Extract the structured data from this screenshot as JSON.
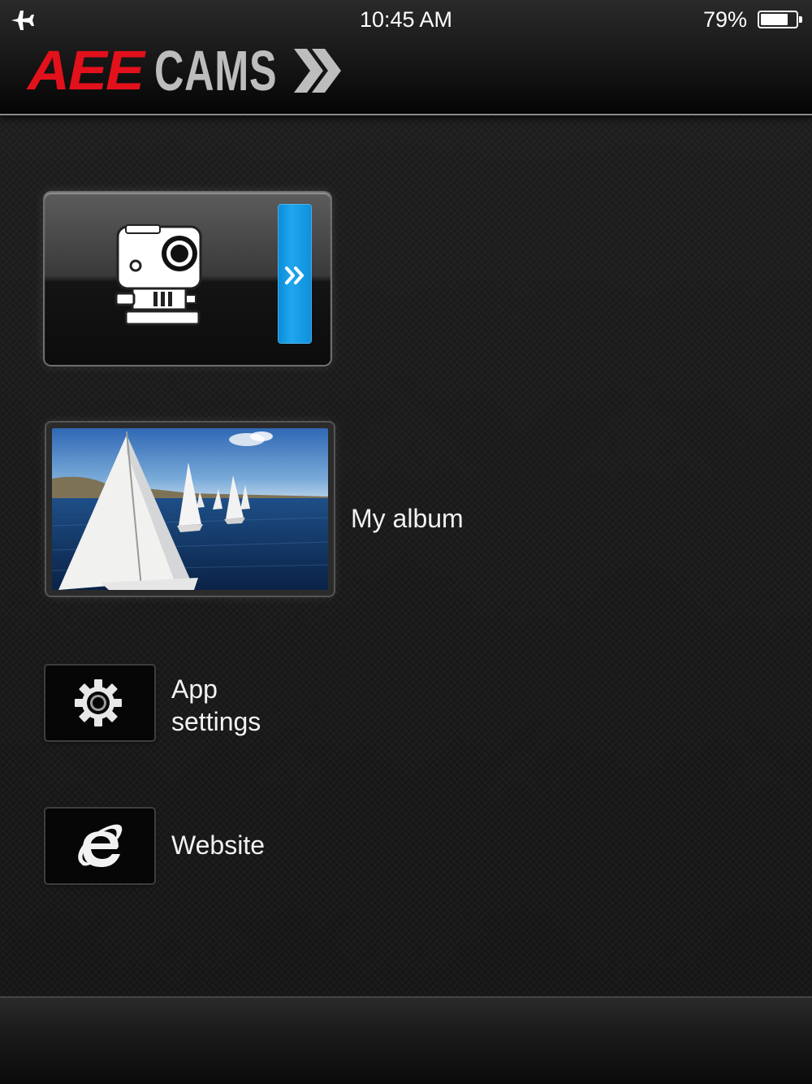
{
  "status_bar": {
    "time": "10:45 AM",
    "battery_percent_label": "79%",
    "battery_level": 0.79,
    "airplane_mode": true
  },
  "header": {
    "logo_brand": "AEE",
    "logo_product": "CAMS"
  },
  "menu": {
    "camera_tile": {
      "icon": "action-camera-icon",
      "accent": "#1ea6ee"
    },
    "album_tile": {
      "label": "My album"
    },
    "settings_tile": {
      "label_line1": "App",
      "label_line2": "settings",
      "icon": "gear-icon"
    },
    "website_tile": {
      "label": "Website",
      "icon": "internet-explorer-icon"
    }
  },
  "colors": {
    "brand_red": "#e3111b",
    "logo_gray": "#bdbdbd",
    "accent_blue": "#1ea6ee",
    "text": "#f2f2f2"
  }
}
